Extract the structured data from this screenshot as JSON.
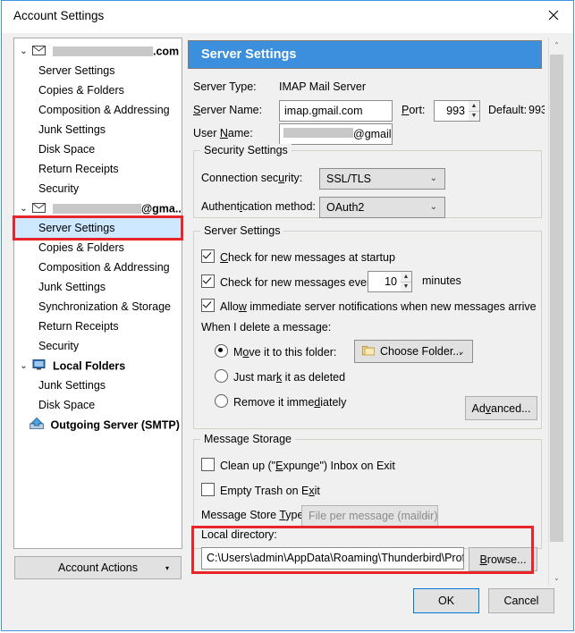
{
  "window": {
    "title": "Account Settings",
    "close_icon": "close-icon",
    "accent_blue": "#3b8fdd",
    "annotation_red": "#e8262a",
    "selection_blue": "#cde8ff"
  },
  "sidebar": {
    "accounts": [
      {
        "label": ".com",
        "redacted": true,
        "icon": "envelope-icon",
        "twisty": "⌄",
        "items": [
          "Server Settings",
          "Copies & Folders",
          "Composition & Addressing",
          "Junk Settings",
          "Disk Space",
          "Return Receipts",
          "Security"
        ]
      },
      {
        "label": "@gma...",
        "redacted": true,
        "icon": "envelope-icon",
        "twisty": "⌄",
        "items": [
          "Server Settings",
          "Copies & Folders",
          "Composition & Addressing",
          "Junk Settings",
          "Synchronization & Storage",
          "Return Receipts",
          "Security"
        ],
        "selected_item": "Server Settings"
      },
      {
        "label": "Local Folders",
        "redacted": false,
        "icon": "computer-icon",
        "twisty": "⌄",
        "items": [
          "Junk Settings",
          "Disk Space"
        ]
      }
    ],
    "smtp": {
      "label": "Outgoing Server (SMTP)",
      "icon": "outgoing-server-icon"
    },
    "account_actions": {
      "label_pre": "A",
      "label_accesskey": "A",
      "label": "Account Actions",
      "caret": "▾"
    }
  },
  "pane": {
    "header": "Server Settings",
    "server_type_label": "Server Type:",
    "server_type_value": "IMAP Mail Server",
    "server_name_label": "Server Name:",
    "server_name_value": "imap.gmail.com",
    "port_label": "Port:",
    "port_value": "993",
    "default_label": "Default:",
    "default_value": "993",
    "user_name_label": "User Name:",
    "user_name_value": "@gmail",
    "security": {
      "group_title": "Security Settings",
      "connection_security_label": "Connection security:",
      "connection_security_value": "SSL/TLS",
      "auth_method_label": "Authentication method:",
      "auth_method_value": "OAuth2"
    },
    "server_settings": {
      "group_title": "Server Settings",
      "check_startup_label": "Check for new messages at startup",
      "check_startup_checked": true,
      "check_every_label": "Check for new messages every",
      "check_every_checked": true,
      "check_every_value": "10",
      "minutes_label": "minutes",
      "allow_notifications_label": "Allow immediate server notifications when new messages arrive",
      "allow_notifications_checked": true,
      "delete_prompt": "When I delete a message:",
      "radio_move_label": "Move it to this folder:",
      "radio_move_selected": true,
      "choose_folder_label": "Choose Folder...",
      "choose_folder_icon": "folder-icon",
      "radio_mark_label": "Just mark it as deleted",
      "radio_remove_label": "Remove it immediately",
      "advanced_label": "Advanced..."
    },
    "message_storage": {
      "group_title": "Message Storage",
      "expunge_label": "Clean up (\"Expunge\") Inbox on Exit",
      "expunge_checked": false,
      "empty_trash_label": "Empty Trash on Exit",
      "empty_trash_checked": false,
      "store_type_label": "Message Store Type:",
      "store_type_value": "File per message (maildir)",
      "store_type_disabled": true
    },
    "local_directory": {
      "label": "Local directory:",
      "value": "C:\\Users\\admin\\AppData\\Roaming\\Thunderbird\\Profi",
      "browse_label": "Browse..."
    }
  },
  "footer": {
    "ok_label": "OK",
    "cancel_label": "Cancel"
  },
  "scrollbar": {
    "up_arrow": "⌃",
    "down_arrow": "⌄"
  }
}
